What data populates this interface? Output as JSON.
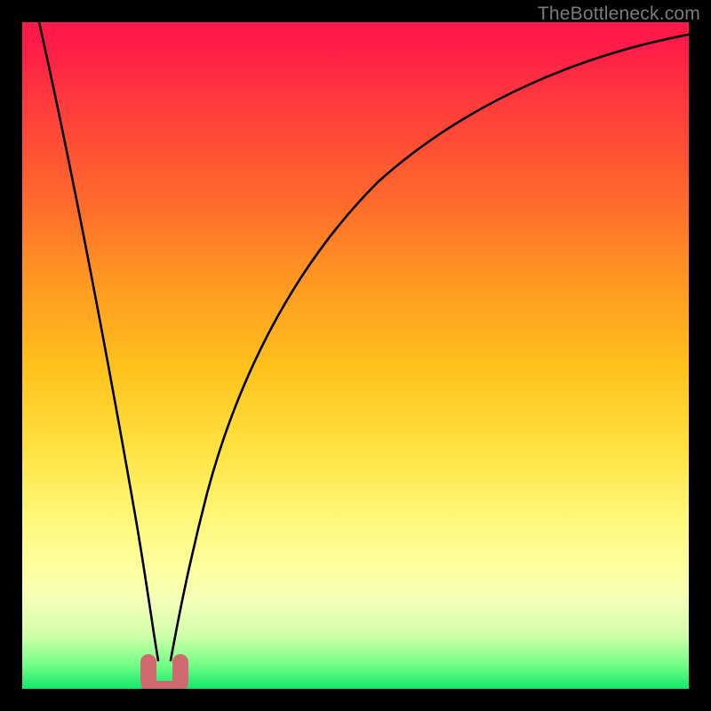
{
  "watermark": "TheBottleneck.com",
  "chart_data": {
    "type": "line",
    "title": "",
    "xlabel": "",
    "ylabel": "",
    "xlim": [
      0,
      100
    ],
    "ylim": [
      0,
      100
    ],
    "grid": false,
    "series": [
      {
        "name": "bottleneck-curve",
        "x": [
          0,
          5,
          9,
          13,
          16,
          18,
          19.5,
          20.5,
          21.5,
          22.5,
          24,
          27,
          31,
          36,
          42,
          50,
          60,
          72,
          86,
          100
        ],
        "values": [
          100,
          78,
          58,
          38,
          22,
          10,
          3,
          0,
          0,
          3,
          11,
          24,
          38,
          50,
          60,
          69,
          77,
          83,
          88,
          91
        ]
      }
    ],
    "marker": {
      "name": "minimum-indicator",
      "x": 21,
      "y": 0,
      "color": "#cf6a6f"
    },
    "background_gradient": {
      "top_color": "#ff1a4a",
      "bottom_color": "#13e96a"
    }
  }
}
